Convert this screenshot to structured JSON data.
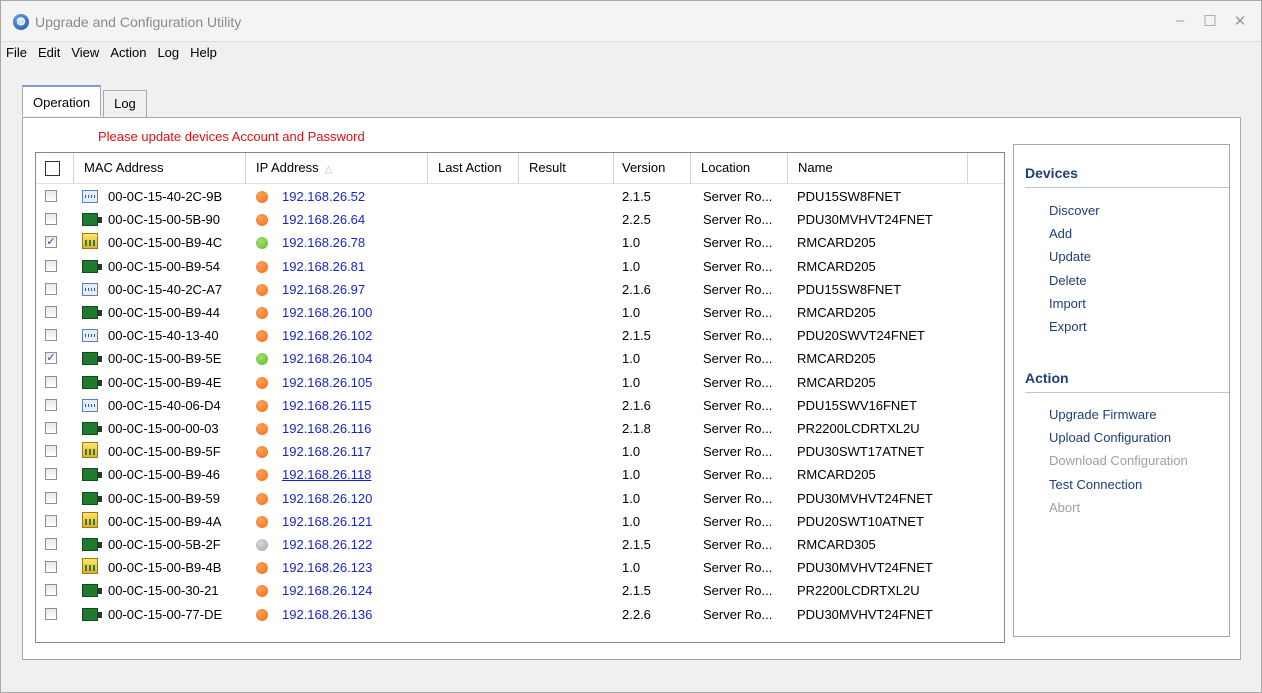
{
  "window": {
    "title": "Upgrade and Configuration Utility",
    "icon": "app-globe-icon"
  },
  "menu": [
    "File",
    "Edit",
    "View",
    "Action",
    "Log",
    "Help"
  ],
  "tabs": {
    "operation": "Operation",
    "log": "Log"
  },
  "warning": "Please update devices Account and Password",
  "columns": {
    "mac": "MAC Address",
    "ip": "IP Address",
    "last_action": "Last Action",
    "result": "Result",
    "version": "Version",
    "location": "Location",
    "name": "Name"
  },
  "devices": [
    {
      "checked": false,
      "icon": "pdu-icon",
      "mac": "00-0C-15-40-2C-9B",
      "status": "orange",
      "ip": "192.168.26.52",
      "version": "2.1.5",
      "location": "Server Ro...",
      "name": "PDU15SW8FNET"
    },
    {
      "checked": false,
      "icon": "card-icon",
      "mac": "00-0C-15-00-5B-90",
      "status": "orange",
      "ip": "192.168.26.64",
      "version": "2.2.5",
      "location": "Server Ro...",
      "name": "PDU30MVHVT24FNET"
    },
    {
      "checked": true,
      "icon": "ups-icon",
      "mac": "00-0C-15-00-B9-4C",
      "status": "green",
      "ip": "192.168.26.78",
      "version": "1.0",
      "location": "Server Ro...",
      "name": "RMCARD205"
    },
    {
      "checked": false,
      "icon": "card-icon",
      "mac": "00-0C-15-00-B9-54",
      "status": "orange",
      "ip": "192.168.26.81",
      "version": "1.0",
      "location": "Server Ro...",
      "name": "RMCARD205"
    },
    {
      "checked": false,
      "icon": "pdu-icon",
      "mac": "00-0C-15-40-2C-A7",
      "status": "orange",
      "ip": "192.168.26.97",
      "version": "2.1.6",
      "location": "Server Ro...",
      "name": "PDU15SW8FNET"
    },
    {
      "checked": false,
      "icon": "card-icon",
      "mac": "00-0C-15-00-B9-44",
      "status": "orange",
      "ip": "192.168.26.100",
      "version": "1.0",
      "location": "Server Ro...",
      "name": "RMCARD205"
    },
    {
      "checked": false,
      "icon": "pdu-icon",
      "mac": "00-0C-15-40-13-40",
      "status": "orange",
      "ip": "192.168.26.102",
      "version": "2.1.5",
      "location": "Server Ro...",
      "name": "PDU20SWVT24FNET"
    },
    {
      "checked": true,
      "icon": "card-icon",
      "mac": "00-0C-15-00-B9-5E",
      "status": "green",
      "ip": "192.168.26.104",
      "version": "1.0",
      "location": "Server Ro...",
      "name": "RMCARD205"
    },
    {
      "checked": false,
      "icon": "card-icon",
      "mac": "00-0C-15-00-B9-4E",
      "status": "orange",
      "ip": "192.168.26.105",
      "version": "1.0",
      "location": "Server Ro...",
      "name": "RMCARD205"
    },
    {
      "checked": false,
      "icon": "pdu-icon",
      "mac": "00-0C-15-40-06-D4",
      "status": "orange",
      "ip": "192.168.26.115",
      "version": "2.1.6",
      "location": "Server Ro...",
      "name": "PDU15SWV16FNET"
    },
    {
      "checked": false,
      "icon": "card-icon",
      "mac": "00-0C-15-00-00-03",
      "status": "orange",
      "ip": "192.168.26.116",
      "version": "2.1.8",
      "location": "Server Ro...",
      "name": "PR2200LCDRTXL2U"
    },
    {
      "checked": false,
      "icon": "ups-icon",
      "mac": "00-0C-15-00-B9-5F",
      "status": "orange",
      "ip": "192.168.26.117",
      "version": "1.0",
      "location": "Server Ro...",
      "name": "PDU30SWT17ATNET"
    },
    {
      "checked": false,
      "icon": "card-icon",
      "mac": "00-0C-15-00-B9-46",
      "status": "orange",
      "ip": "192.168.26.118",
      "version": "1.0",
      "location": "Server Ro...",
      "name": "RMCARD205",
      "underline": true
    },
    {
      "checked": false,
      "icon": "card-icon",
      "mac": "00-0C-15-00-B9-59",
      "status": "orange",
      "ip": "192.168.26.120",
      "version": "1.0",
      "location": "Server Ro...",
      "name": "PDU30MVHVT24FNET"
    },
    {
      "checked": false,
      "icon": "ups-icon",
      "mac": "00-0C-15-00-B9-4A",
      "status": "orange",
      "ip": "192.168.26.121",
      "version": "1.0",
      "location": "Server Ro...",
      "name": "PDU20SWT10ATNET"
    },
    {
      "checked": false,
      "icon": "card-icon",
      "mac": "00-0C-15-00-5B-2F",
      "status": "gray",
      "ip": "192.168.26.122",
      "version": "2.1.5",
      "location": "Server Ro...",
      "name": "RMCARD305"
    },
    {
      "checked": false,
      "icon": "ups-icon",
      "mac": "00-0C-15-00-B9-4B",
      "status": "orange",
      "ip": "192.168.26.123",
      "version": "1.0",
      "location": "Server Ro...",
      "name": "PDU30MVHVT24FNET"
    },
    {
      "checked": false,
      "icon": "card-icon",
      "mac": "00-0C-15-00-30-21",
      "status": "orange",
      "ip": "192.168.26.124",
      "version": "2.1.5",
      "location": "Server Ro...",
      "name": "PR2200LCDRTXL2U"
    },
    {
      "checked": false,
      "icon": "card-icon",
      "mac": "00-0C-15-00-77-DE",
      "status": "orange",
      "ip": "192.168.26.136",
      "version": "2.2.6",
      "location": "Server Ro...",
      "name": "PDU30MVHVT24FNET"
    }
  ],
  "side": {
    "devices_title": "Devices",
    "devices_links": [
      "Discover",
      "Add",
      "Update",
      "Delete",
      "Import",
      "Export"
    ],
    "action_title": "Action",
    "action_links": [
      {
        "label": "Upgrade Firmware",
        "enabled": true
      },
      {
        "label": "Upload Configuration",
        "enabled": true
      },
      {
        "label": "Download Configuration",
        "enabled": false
      },
      {
        "label": "Test Connection",
        "enabled": true
      },
      {
        "label": "Abort",
        "enabled": false
      }
    ]
  },
  "colors": {
    "accent": "#1f3f74",
    "link": "#1a25c8",
    "warning": "#e01010",
    "status_orange": "#f36c16",
    "status_green": "#5cb82e",
    "status_gray": "#a7a7a7"
  }
}
